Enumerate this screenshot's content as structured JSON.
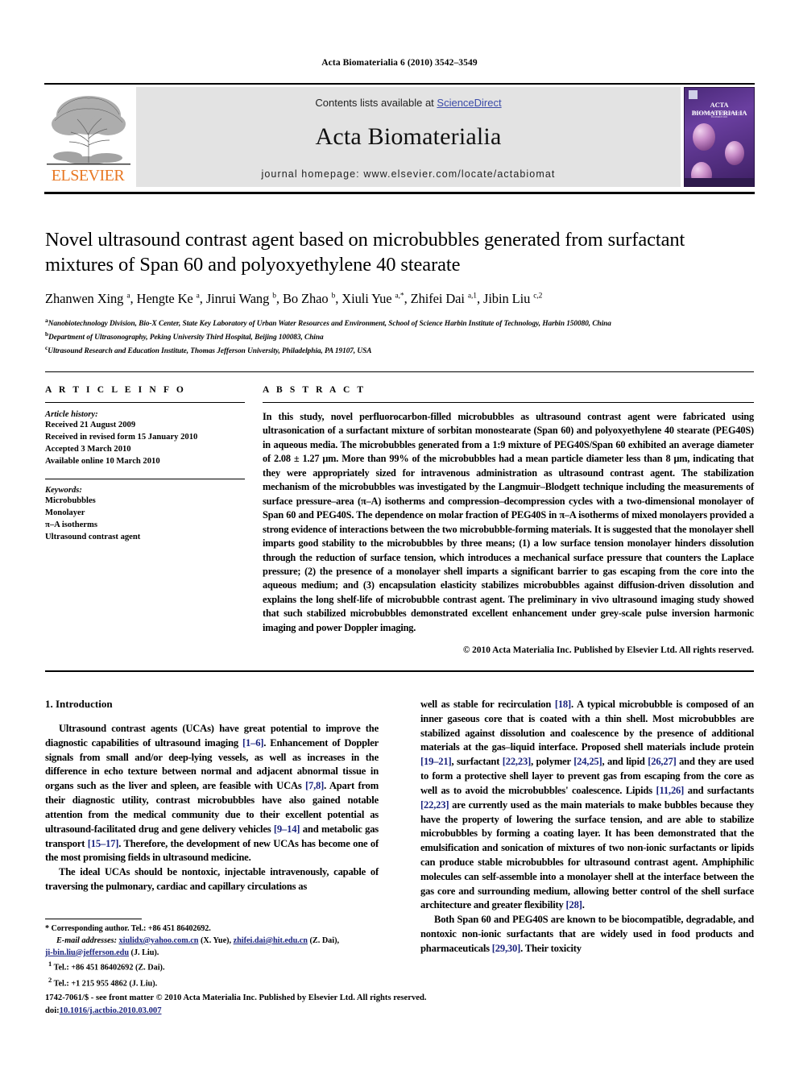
{
  "running_head": "Acta Biomaterialia 6 (2010) 3542–3549",
  "header": {
    "contents_prefix": "Contents lists available at ",
    "sciencedirect": "ScienceDirect",
    "journal_title": "Acta Biomaterialia",
    "homepage": "journal homepage: www.elsevier.com/locate/actabiomat",
    "publisher_logo_text": "ELSEVIER",
    "cover_title": "ACTA BIOMATERIALIA",
    "cover_subtitle": "The Acta Journals for Acta Materialia in Biomaterials"
  },
  "article": {
    "title": "Novel ultrasound contrast agent based on microbubbles generated from surfactant mixtures of Span 60 and polyoxyethylene 40 stearate",
    "authors_html": "Zhanwen Xing <sup>a</sup>, Hengte Ke <sup>a</sup>, Jinrui Wang <sup>b</sup>, Bo Zhao <sup>b</sup>, Xiuli Yue <sup>a,*</sup>, Zhifei Dai <sup>a,1</sup>, Jibin Liu <sup>c,2</sup>",
    "affiliations": [
      "Nanobiotechnology Division, Bio-X Center, State Key Laboratory of Urban Water Resources and Environment, School of Science Harbin Institute of Technology, Harbin 150080, China",
      "Department of Ultrasonography, Peking University Third Hospital, Beijing 100083, China",
      "Ultrasound Research and Education Institute, Thomas Jefferson University, Philadelphia, PA 19107, USA"
    ],
    "affiliation_marks": [
      "a",
      "b",
      "c"
    ]
  },
  "article_info": {
    "heading": "A R T I C L E  I N F O",
    "history_label": "Article history:",
    "history": [
      "Received 21 August 2009",
      "Received in revised form 15 January 2010",
      "Accepted 3 March 2010",
      "Available online 10 March 2010"
    ],
    "keywords_label": "Keywords:",
    "keywords": [
      "Microbubbles",
      "Monolayer",
      "π–A isotherms",
      "Ultrasound contrast agent"
    ]
  },
  "abstract": {
    "heading": "A B S T R A C T",
    "text": "In this study, novel perfluorocarbon-filled microbubbles as ultrasound contrast agent were fabricated using ultrasonication of a surfactant mixture of sorbitan monostearate (Span 60) and polyoxyethylene 40 stearate (PEG40S) in aqueous media. The microbubbles generated from a 1:9 mixture of PEG40S/Span 60 exhibited an average diameter of 2.08 ± 1.27 μm. More than 99% of the microbubbles had a mean particle diameter less than 8 μm, indicating that they were appropriately sized for intravenous administration as ultrasound contrast agent. The stabilization mechanism of the microbubbles was investigated by the Langmuir–Blodgett technique including the measurements of surface pressure–area (π–A) isotherms and compression–decompression cycles with a two-dimensional monolayer of Span 60 and PEG40S. The dependence on molar fraction of PEG40S in π–A isotherms of mixed monolayers provided a strong evidence of interactions between the two microbubble-forming materials. It is suggested that the monolayer shell imparts good stability to the microbubbles by three means; (1) a low surface tension monolayer hinders dissolution through the reduction of surface tension, which introduces a mechanical surface pressure that counters the Laplace pressure; (2) the presence of a monolayer shell imparts a significant barrier to gas escaping from the core into the aqueous medium; and (3) encapsulation elasticity stabilizes microbubbles against diffusion-driven dissolution and explains the long shelf-life of microbubble contrast agent. The preliminary in vivo ultrasound imaging study showed that such stabilized microbubbles demonstrated excellent enhancement under grey-scale pulse inversion harmonic imaging and power Doppler imaging.",
    "copyright": "© 2010 Acta Materialia Inc. Published by Elsevier Ltd. All rights reserved."
  },
  "body": {
    "section_heading": "1. Introduction",
    "left_paragraphs": [
      "Ultrasound contrast agents (UCAs) have great potential to improve the diagnostic capabilities of ultrasound imaging [1–6]. Enhancement of Doppler signals from small and/or deep-lying vessels, as well as increases in the difference in echo texture between normal and adjacent abnormal tissue in organs such as the liver and spleen, are feasible with UCAs [7,8]. Apart from their diagnostic utility, contrast microbubbles have also gained notable attention from the medical community due to their excellent potential as ultrasound-facilitated drug and gene delivery vehicles [9–14] and metabolic gas transport [15–17]. Therefore, the development of new UCAs has become one of the most promising fields in ultrasound medicine.",
      "The ideal UCAs should be nontoxic, injectable intravenously, capable of traversing the pulmonary, cardiac and capillary circulations as"
    ],
    "right_paragraphs": [
      "well as stable for recirculation [18]. A typical microbubble is composed of an inner gaseous core that is coated with a thin shell. Most microbubbles are stabilized against dissolution and coalescence by the presence of additional materials at the gas–liquid interface. Proposed shell materials include protein [19–21], surfactant [22,23], polymer [24,25], and lipid [26,27] and they are used to form a protective shell layer to prevent gas from escaping from the core as well as to avoid the microbubbles' coalescence. Lipids [11,26] and surfactants [22,23] are currently used as the main materials to make bubbles because they have the property of lowering the surface tension, and are able to stabilize microbubbles by forming a coating layer. It has been demonstrated that the emulsification and sonication of mixtures of two non-ionic surfactants or lipids can produce stable microbubbles for ultrasound contrast agent. Amphiphilic molecules can self-assemble into a monolayer shell at the interface between the gas core and surrounding medium, allowing better control of the shell surface architecture and greater flexibility [28].",
      "Both Span 60 and PEG40S are known to be biocompatible, degradable, and nontoxic non-ionic surfactants that are widely used in food products and pharmaceuticals [29,30]. Their toxicity"
    ]
  },
  "footnotes": {
    "corresponding": "Corresponding author. Tel.: +86 451 86402692.",
    "email_label": "E-mail addresses:",
    "email_1": "xiulidx@yahoo.com.cn",
    "email_1_who": "(X. Yue),",
    "email_2": "zhifei.dai@hit.edu.cn",
    "email_2_who": "(Z. Dai),",
    "email_3": "ji-bin.liu@jefferson.edu",
    "email_3_who": "(J. Liu).",
    "note_1": "Tel.: +86 451 86402692 (Z. Dai).",
    "note_2": "Tel.: +1 215 955 4862 (J. Liu).",
    "marker_1": "1",
    "marker_2": "2",
    "marker_star": "*"
  },
  "page_footer": {
    "issn_line": "1742-7061/$ - see front matter © 2010 Acta Materialia Inc. Published by Elsevier Ltd. All rights reserved.",
    "doi_label": "doi:",
    "doi_value": "10.1016/j.actbio.2010.03.007"
  },
  "colors": {
    "link": "#1a237e",
    "sciencedirect": "#3b4ba8",
    "elsevier_orange": "#E87722",
    "band_grey": "#e3e3e3"
  }
}
